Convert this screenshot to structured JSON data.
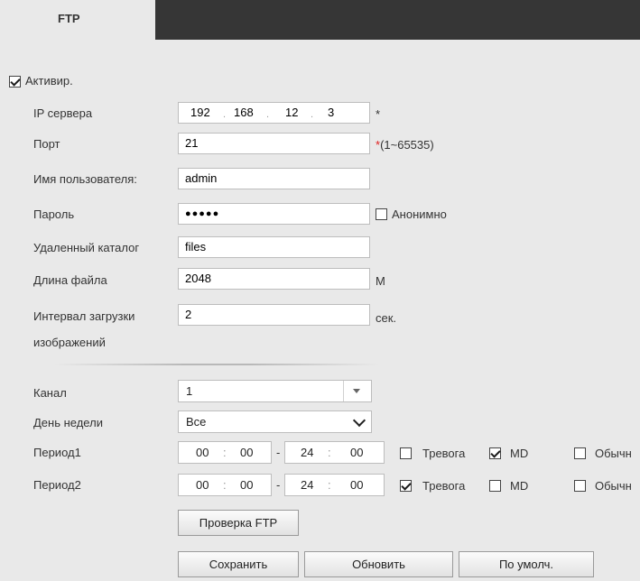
{
  "tabs": {
    "active_label": "FTP"
  },
  "enable": {
    "label": "Активир.",
    "checked": true
  },
  "server_ip": {
    "label": "IP сервера",
    "octets": [
      "192",
      "168",
      "12",
      "3"
    ],
    "required_mark": "*"
  },
  "port": {
    "label": "Порт",
    "value": "21",
    "required_mark": "*",
    "range_hint": "(1~65535)"
  },
  "username": {
    "label": "Имя пользователя:",
    "value": "admin"
  },
  "password": {
    "label": "Пароль",
    "masked_value": "●●●●●",
    "anonymous_label": "Анонимно",
    "anonymous_checked": false
  },
  "remote_dir": {
    "label": "Удаленный каталог",
    "value": "files"
  },
  "file_length": {
    "label": "Длина файла",
    "value": "2048",
    "unit": "M"
  },
  "upload_interval": {
    "label_line1": "Интервал загрузки",
    "label_line2": "изображений",
    "value": "2",
    "unit": "сек."
  },
  "channel": {
    "label": "Канал",
    "value": "1"
  },
  "weekday": {
    "label": "День недели",
    "value": "Все"
  },
  "period1": {
    "label": "Период1",
    "start_h": "00",
    "start_m": "00",
    "end_h": "24",
    "end_m": "00",
    "alarm_label": "Тревога",
    "alarm_checked": false,
    "md_label": "MD",
    "md_checked": true,
    "regular_label": "Обычн",
    "regular_checked": false
  },
  "period2": {
    "label": "Период2",
    "start_h": "00",
    "start_m": "00",
    "end_h": "24",
    "end_m": "00",
    "alarm_label": "Тревога",
    "alarm_checked": true,
    "md_label": "MD",
    "md_checked": false,
    "regular_label": "Обычн",
    "regular_checked": false
  },
  "buttons": {
    "test_ftp": "Проверка FTP",
    "save": "Сохранить",
    "refresh": "Обновить",
    "default": "По умолч."
  },
  "misc": {
    "time_sep": ":",
    "range_sep": "-",
    "ip_sep": "."
  }
}
